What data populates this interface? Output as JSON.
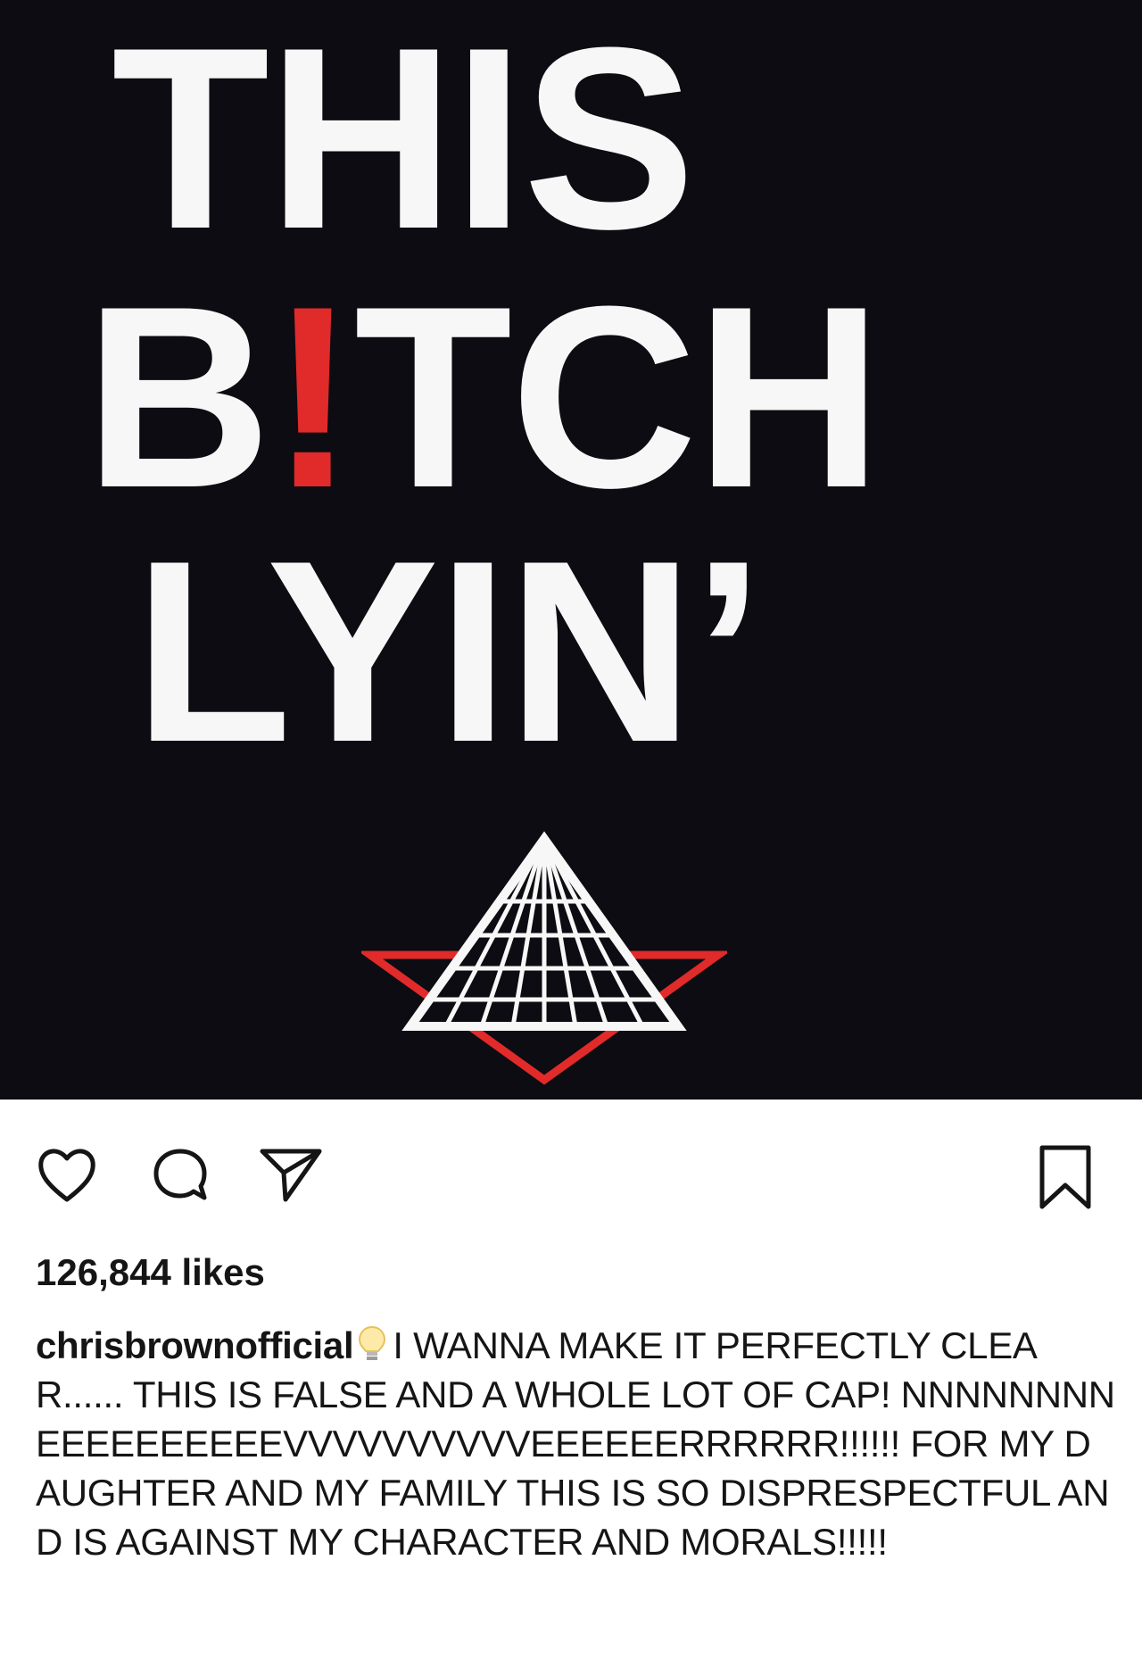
{
  "post": {
    "graphic": {
      "line1": "THIS",
      "line2_prefix": "B",
      "line2_bang": "!",
      "line2_suffix": "TCH",
      "line3": "LYIN’"
    },
    "actions": {
      "like_icon": "heart-outline",
      "comment_icon": "speech-bubble",
      "share_icon": "paper-plane",
      "save_icon": "bookmark"
    },
    "likes_label": "126,844 likes",
    "caption": {
      "username": "chrisbrownofficial",
      "emoji": "lightbulb",
      "text": "I WANNA MAKE IT PERFECTLY CLEAR...... THIS IS FALSE AND A WHOLE LOT OF CAP! NNNNNNNNEEEEEEEEEEVVVVVVVVVVEEEEEERRRRRR!!!!!! FOR MY DAUGHTER AND MY FAMILY THIS IS SO DISPRESPECTFUL AND IS AGAINST MY CHARACTER AND MORALS!!!!!"
    }
  },
  "colors": {
    "image_background": "#0c0c12",
    "graphic_text": "#f7f7f7",
    "accent_red": "#e12a2a",
    "text": "#151515"
  }
}
